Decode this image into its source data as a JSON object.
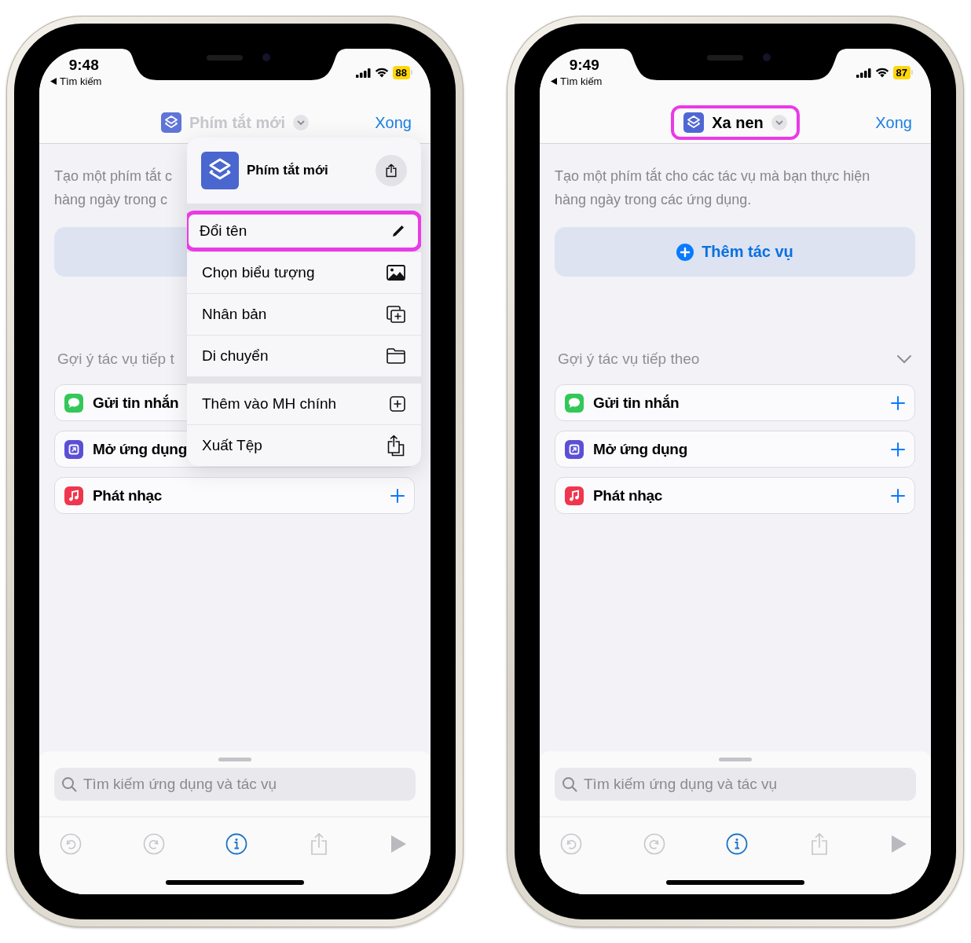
{
  "phones": [
    {
      "time": "9:48",
      "back_label": "Tìm kiếm",
      "battery": "88",
      "title": {
        "text": "Phím tắt mới",
        "dimmed": true,
        "highlighted": false
      },
      "done": "Xong",
      "description_lines": [
        "Tạo một phím tắt c",
        "hàng ngày trong c"
      ],
      "suggestions_header": "Gợi ý tác vụ tiếp t",
      "suggestions": [
        {
          "label": "Gửi tin nhắn",
          "kind": "messages"
        },
        {
          "label": "Mở ứng dụng",
          "kind": "app"
        },
        {
          "label": "Phát nhạc",
          "kind": "music"
        }
      ],
      "search": {
        "placeholder": "Tìm kiếm ứng dụng và tác vụ"
      },
      "menu": {
        "title": "Phím tắt mới",
        "groups": [
          [
            {
              "label": "Đổi tên",
              "kind": "pencil",
              "highlighted": true
            },
            {
              "label": "Chọn biểu tượng",
              "kind": "image",
              "highlighted": false
            },
            {
              "label": "Nhân bản",
              "kind": "duplicate",
              "highlighted": false
            },
            {
              "label": "Di chuyển",
              "kind": "folder",
              "highlighted": false
            }
          ],
          [
            {
              "label": "Thêm vào MH chính",
              "kind": "add-square",
              "highlighted": false
            },
            {
              "label": "Xuất Tệp",
              "kind": "share",
              "highlighted": false
            }
          ]
        ]
      }
    },
    {
      "time": "9:49",
      "back_label": "Tìm kiếm",
      "battery": "87",
      "title": {
        "text": "Xa nen",
        "dimmed": false,
        "highlighted": true
      },
      "done": "Xong",
      "description_lines": [
        "Tạo một phím tắt cho các tác vụ mà bạn thực hiện",
        "hàng ngày trong các ứng dụng."
      ],
      "add_action": {
        "label": "Thêm tác vụ"
      },
      "suggestions_header": "Gợi ý tác vụ tiếp theo",
      "suggestions": [
        {
          "label": "Gửi tin nhắn",
          "kind": "messages"
        },
        {
          "label": "Mở ứng dụng",
          "kind": "app"
        },
        {
          "label": "Phát nhạc",
          "kind": "music"
        }
      ],
      "search": {
        "placeholder": "Tìm kiếm ứng dụng và tác vụ"
      }
    }
  ]
}
